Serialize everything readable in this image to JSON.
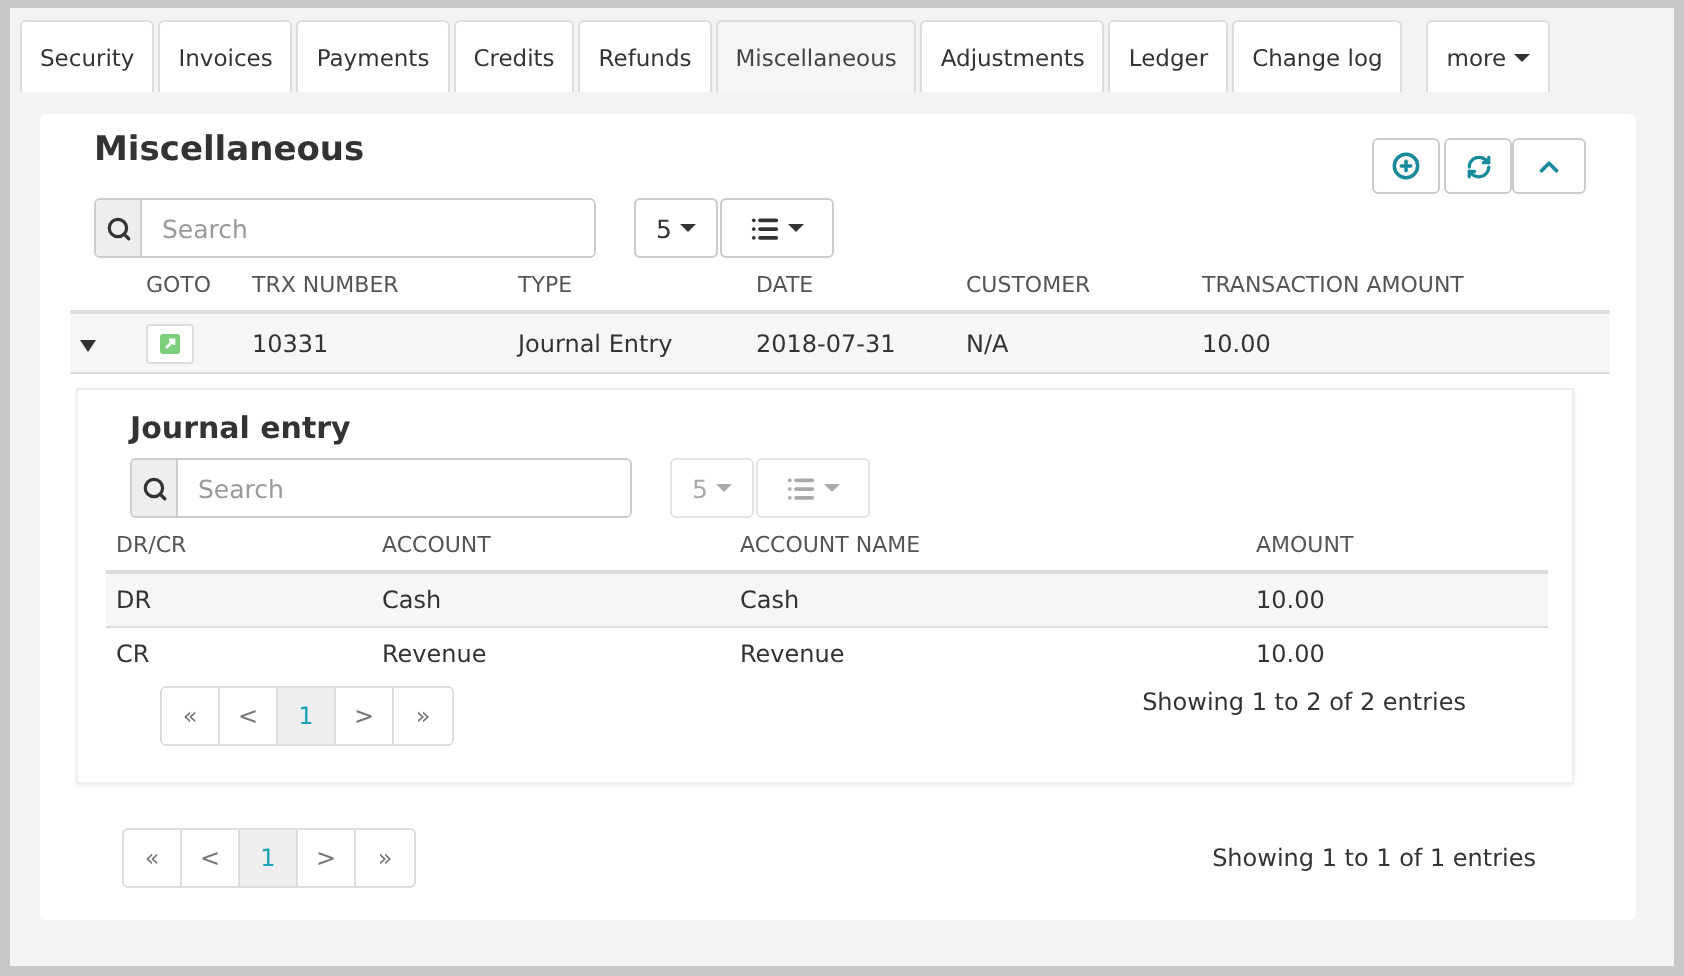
{
  "tabs": [
    {
      "label": "Security",
      "selected": false
    },
    {
      "label": "Invoices",
      "selected": false
    },
    {
      "label": "Payments",
      "selected": false
    },
    {
      "label": "Credits",
      "selected": false
    },
    {
      "label": "Refunds",
      "selected": false
    },
    {
      "label": "Miscellaneous",
      "selected": true
    },
    {
      "label": "Adjustments",
      "selected": false
    },
    {
      "label": "Ledger",
      "selected": false
    },
    {
      "label": "Change log",
      "selected": false
    }
  ],
  "more_tab": {
    "label": "more"
  },
  "panel": {
    "title": "Miscellaneous",
    "search": {
      "placeholder": "Search"
    },
    "page_size": {
      "value": "5",
      "disabled": false
    },
    "table": {
      "columns": [
        "",
        "GOTO",
        "TRX NUMBER",
        "TYPE",
        "DATE",
        "CUSTOMER",
        "TRANSACTION AMOUNT"
      ],
      "rows": [
        {
          "expanded": true,
          "trx_number": "10331",
          "type": "Journal Entry",
          "date": "2018-07-31",
          "customer": "N/A",
          "amount": "10.00"
        }
      ]
    },
    "detail": {
      "title": "Journal entry",
      "search": {
        "placeholder": "Search"
      },
      "page_size": {
        "value": "5",
        "disabled": true
      },
      "columns": [
        "DR/CR",
        "ACCOUNT",
        "ACCOUNT NAME",
        "AMOUNT"
      ],
      "rows": [
        [
          "DR",
          "Cash",
          "Cash",
          "10.00"
        ],
        [
          "CR",
          "Revenue",
          "Revenue",
          "10.00"
        ]
      ],
      "pages": [
        {
          "label": "«",
          "selected": false
        },
        {
          "label": "<",
          "selected": false
        },
        {
          "label": "1",
          "selected": true
        },
        {
          "label": ">",
          "selected": false
        },
        {
          "label": "»",
          "selected": false
        }
      ],
      "info": "Showing 1 to 2 of 2 entries"
    },
    "pages": [
      {
        "label": "«",
        "selected": false
      },
      {
        "label": "<",
        "selected": false
      },
      {
        "label": "1",
        "selected": true
      },
      {
        "label": ">",
        "selected": false
      },
      {
        "label": "»",
        "selected": false
      }
    ],
    "info": "Showing 1 to 1 of 1 entries"
  }
}
